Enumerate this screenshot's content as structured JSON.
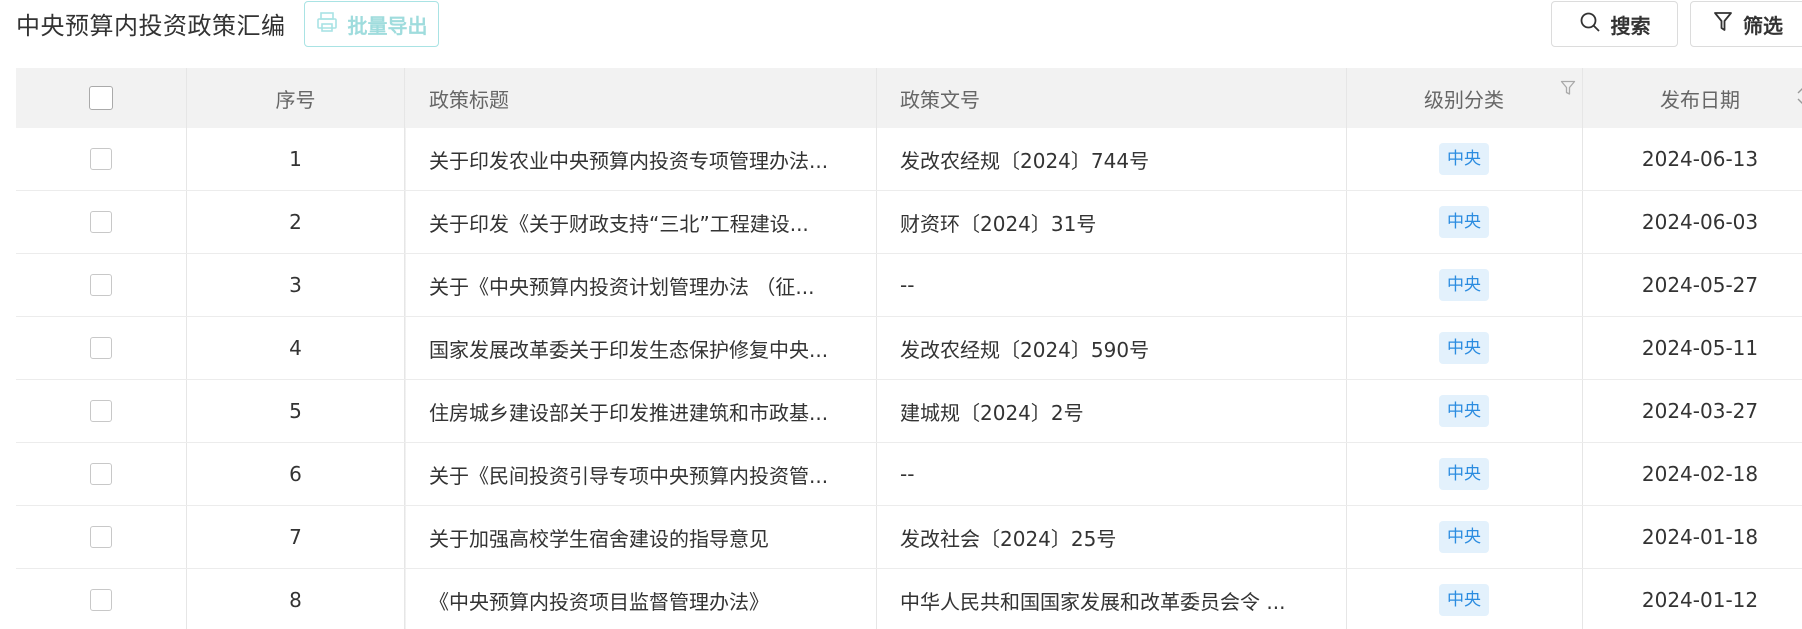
{
  "header": {
    "title": "中央预算内投资政策汇编",
    "export_label": "批量导出",
    "search_label": "搜索",
    "filter_label": "筛选"
  },
  "table": {
    "columns": {
      "index": "序号",
      "title": "政策标题",
      "doc_no": "政策文号",
      "level": "级别分类",
      "date": "发布日期"
    },
    "rows": [
      {
        "index": "1",
        "title": "关于印发农业中央预算内投资专项管理办法...",
        "doc_no": "发改农经规〔2024〕744号",
        "level": "中央",
        "date": "2024-06-13"
      },
      {
        "index": "2",
        "title": "关于印发《关于财政支持“三北”工程建设...",
        "doc_no": "财资环〔2024〕31号",
        "level": "中央",
        "date": "2024-06-03"
      },
      {
        "index": "3",
        "title": "关于《中央预算内投资计划管理办法 （征...",
        "doc_no": "--",
        "level": "中央",
        "date": "2024-05-27"
      },
      {
        "index": "4",
        "title": "国家发展改革委关于印发生态保护修复中央...",
        "doc_no": "发改农经规〔2024〕590号",
        "level": "中央",
        "date": "2024-05-11"
      },
      {
        "index": "5",
        "title": "住房城乡建设部关于印发推进建筑和市政基...",
        "doc_no": "建城规〔2024〕2号",
        "level": "中央",
        "date": "2024-03-27"
      },
      {
        "index": "6",
        "title": "关于《民间投资引导专项中央预算内投资管...",
        "doc_no": "--",
        "level": "中央",
        "date": "2024-02-18"
      },
      {
        "index": "7",
        "title": "关于加强高校学生宿舍建设的指导意见",
        "doc_no": "发改社会〔2024〕25号",
        "level": "中央",
        "date": "2024-01-18"
      },
      {
        "index": "8",
        "title": "《中央预算内投资项目监督管理办法》",
        "doc_no": "中华人民共和国国家发展和改革委员会令 ...",
        "level": "中央",
        "date": "2024-01-12"
      }
    ]
  },
  "colors": {
    "accent": "#9fdcdd",
    "tag_bg": "#e3f1fc",
    "tag_text": "#2b8ce0",
    "header_bg": "#f2f2f2"
  },
  "icons": {
    "export": "printer-icon",
    "search": "search-icon",
    "filter": "filter-icon",
    "column_filter": "funnel-icon",
    "sort": "sort-icon"
  }
}
